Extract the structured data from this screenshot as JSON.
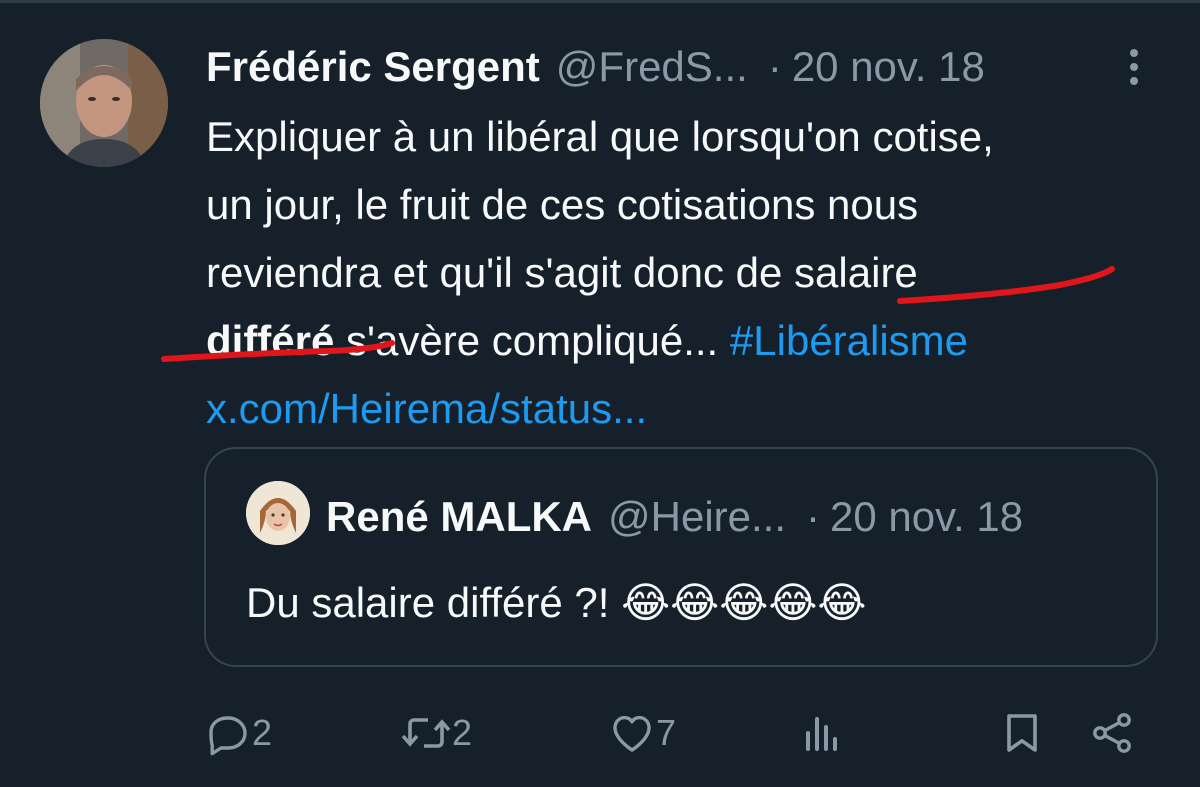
{
  "tweet": {
    "author_name": "Frédéric Sergent",
    "author_handle": "@FredS...",
    "separator": "·",
    "date": "20 nov. 18",
    "text_lines": [
      "Expliquer à un libéral que lorsqu'on cotise,",
      "un jour, le fruit de ces cotisations nous",
      "reviendra et qu'il s'agit donc de salaire"
    ],
    "line4_bold": "différé",
    "line4_rest": " s'avère compliqué... ",
    "hashtag": "#Libéralisme",
    "link": "x.com/Heirema/status..."
  },
  "quote": {
    "author_name": "René MALKA",
    "author_handle": "@Heire...",
    "separator": "·",
    "date": "20 nov. 18",
    "text": "Du salaire différé ?! 😂😂😂😂😂"
  },
  "actions": {
    "replies": "2",
    "reposts": "2",
    "likes": "7"
  },
  "icons": [
    "more-icon",
    "reply-icon",
    "repost-icon",
    "like-icon",
    "views-icon",
    "bookmark-icon",
    "share-icon"
  ],
  "colors": {
    "background": "#15202b",
    "text": "#f7f9f9",
    "muted": "#8b98a5",
    "link": "#1d9bf0",
    "annotation": "#e0161b"
  }
}
